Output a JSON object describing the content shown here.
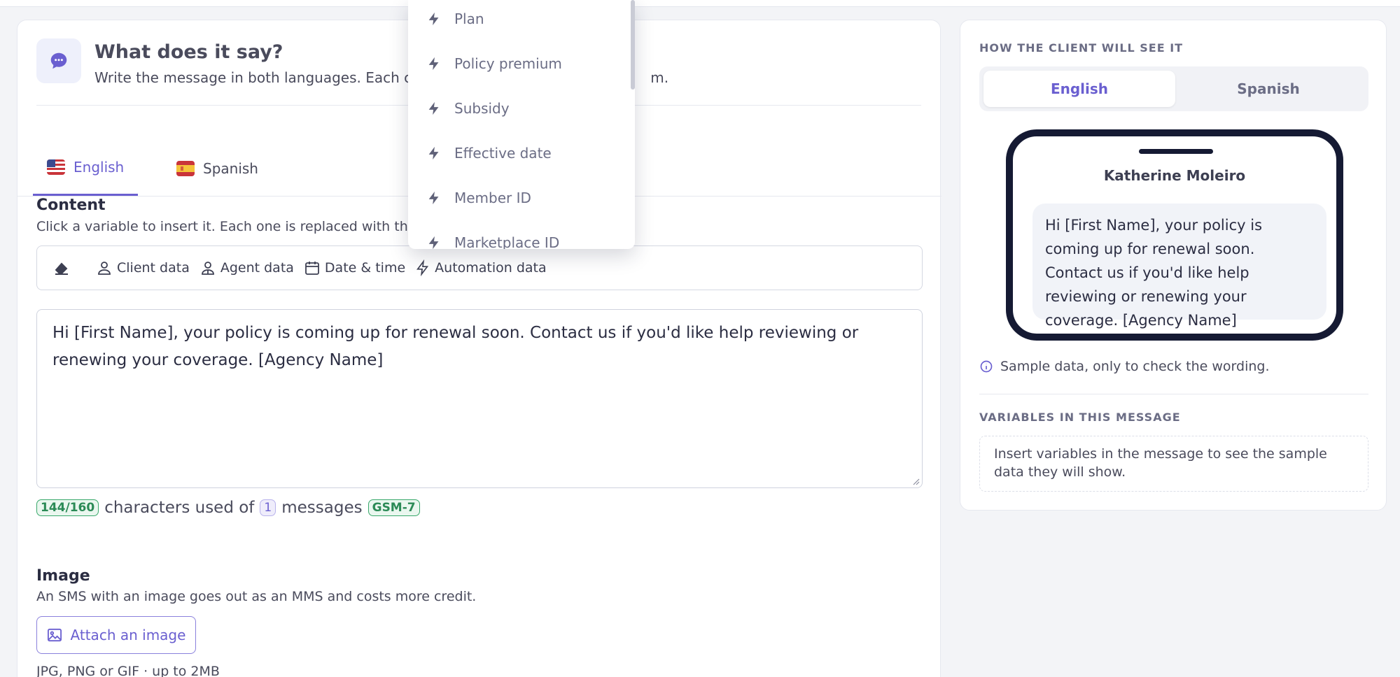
{
  "editor_header": {
    "title": "What does it say?",
    "subtitle_start": "Write the message in both languages. Each cli",
    "subtitle_end": "m."
  },
  "language_tabs": [
    {
      "label": "English",
      "active": true
    },
    {
      "label": "Spanish",
      "active": false
    }
  ],
  "content_section": {
    "title": "Content",
    "subtitle": "Click a variable to insert it. Each one is replaced with tho"
  },
  "toolbar": {
    "eraser_icon": "eraser-icon",
    "items": [
      {
        "label": "Client data",
        "icon": "user-icon"
      },
      {
        "label": "Agent data",
        "icon": "agent-icon"
      },
      {
        "label": "Date & time",
        "icon": "calendar-icon"
      },
      {
        "label": "Automation data",
        "icon": "bolt-icon"
      }
    ]
  },
  "message": {
    "text": "Hi [First Name], your policy is coming up for renewal soon. Contact us if you'd like help reviewing or renewing your coverage. [Agency Name]"
  },
  "counter": {
    "count": "144/160",
    "text_used": "characters used of",
    "messages_count": "1",
    "text_messages": "messages",
    "encoding": "GSM-7"
  },
  "image_section": {
    "title": "Image",
    "subtitle": "An SMS with an image goes out as an MMS and costs more credit.",
    "attach_label": "Attach an image",
    "hint": "JPG, PNG or GIF · up to 2MB"
  },
  "automation_dropdown": {
    "items": [
      "Plan",
      "Policy premium",
      "Subsidy",
      "Effective date",
      "Member ID",
      "Marketplace ID"
    ]
  },
  "preview": {
    "label": "HOW THE CLIENT WILL SEE IT",
    "tabs": [
      {
        "label": "English",
        "active": true
      },
      {
        "label": "Spanish",
        "active": false
      }
    ],
    "contact_name": "Katherine Moleiro",
    "bubble_text": "Hi [First Name], your policy is coming up for renewal soon. Contact us if you'd like help reviewing or renewing your coverage. [Agency Name]",
    "note": "Sample data, only to check the wording.",
    "vars_label": "VARIABLES IN THIS MESSAGE",
    "vars_empty": "Insert variables in the message to see the sample data they will show."
  },
  "colors": {
    "accent": "#6a5fd0",
    "phone_frame": "#151a33",
    "success": "#2b8a56"
  }
}
